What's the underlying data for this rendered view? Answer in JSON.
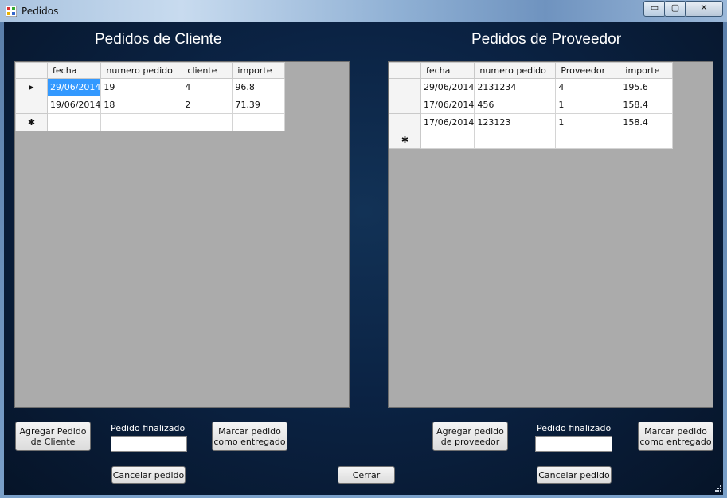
{
  "window": {
    "title": "Pedidos",
    "controls": {
      "minimize": "▭",
      "maximize": "▢",
      "close": "✕"
    }
  },
  "cliente": {
    "heading": "Pedidos de Cliente",
    "columns": [
      "fecha",
      "numero pedido",
      "cliente",
      "importe"
    ],
    "rows": [
      {
        "fecha": "29/06/2014",
        "numero_pedido": "19",
        "cliente": "4",
        "importe": "96.8",
        "selected": true
      },
      {
        "fecha": "19/06/2014",
        "numero_pedido": "18",
        "cliente": "2",
        "importe": "71.39"
      }
    ],
    "buttons": {
      "agregar": "Agregar Pedido de Cliente",
      "marcar": "Marcar pedido como entregado",
      "cancelar": "Cancelar pedido"
    },
    "finalizado_label": "Pedido finalizado",
    "finalizado_value": ""
  },
  "proveedor": {
    "heading": "Pedidos de Proveedor",
    "columns": [
      "fecha",
      "numero pedido",
      "Proveedor",
      "importe"
    ],
    "rows": [
      {
        "fecha": "29/06/2014",
        "numero_pedido": "2131234",
        "proveedor": "4",
        "importe": "195.6"
      },
      {
        "fecha": "17/06/2014",
        "numero_pedido": "456",
        "proveedor": "1",
        "importe": "158.4"
      },
      {
        "fecha": "17/06/2014",
        "numero_pedido": "123123",
        "proveedor": "1",
        "importe": "158.4"
      }
    ],
    "buttons": {
      "agregar": "Agregar pedido de proveedor",
      "marcar": "Marcar pedido como entregado",
      "cancelar": "Cancelar pedido"
    },
    "finalizado_label": "Pedido finalizado",
    "finalizado_value": ""
  },
  "footer": {
    "cerrar": "Cerrar"
  },
  "grid_glyphs": {
    "current_row": "▶",
    "new_row": "✱"
  },
  "colors": {
    "selection": "#3399ff",
    "grid_bg": "#ababab"
  }
}
